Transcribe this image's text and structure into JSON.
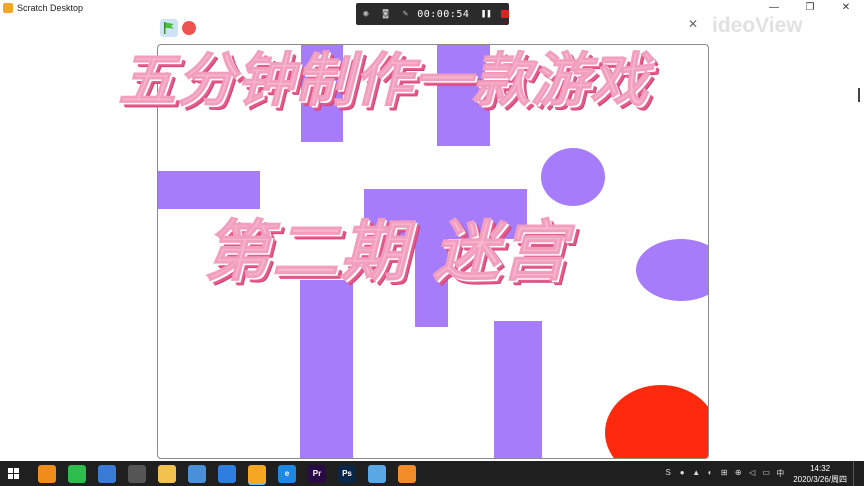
{
  "window": {
    "title": "Scratch Desktop",
    "controls": [
      "—",
      "❐",
      "✕"
    ]
  },
  "recorder": {
    "time": "00:00:54"
  },
  "watermark": {
    "text": "ideoView"
  },
  "overlay": {
    "title_line1": "五分钟制作一款游戏",
    "title_line2": "第二期 迷宫"
  },
  "colors": {
    "wall": "#a67cfa",
    "ball": "#ff2a0e",
    "title_fill": "#f7b7cf",
    "title_shadow": "#d24377"
  },
  "taskbar": {
    "apps": [
      {
        "name": "browser-icon",
        "label": "",
        "color": "#f08c1a"
      },
      {
        "name": "wechat-icon",
        "label": "",
        "color": "#2dbd4e"
      },
      {
        "name": "computer-icon",
        "label": "",
        "color": "#3a7bd5"
      },
      {
        "name": "app-icon",
        "label": "",
        "color": "#555555"
      },
      {
        "name": "folder-icon",
        "label": "",
        "color": "#f2c14e"
      },
      {
        "name": "network-icon",
        "label": "",
        "color": "#4a90d9"
      },
      {
        "name": "tiles-icon",
        "label": "",
        "color": "#2f7de1"
      },
      {
        "name": "scratch-icon",
        "label": "",
        "color": "#f5a623"
      },
      {
        "name": "ie-icon",
        "label": "e",
        "color": "#1e88e5"
      },
      {
        "name": "premiere-icon",
        "label": "Pr",
        "color": "#2a0a44"
      },
      {
        "name": "photoshop-icon",
        "label": "Ps",
        "color": "#0b2547"
      },
      {
        "name": "paint-icon",
        "label": "",
        "color": "#5aa9e6"
      },
      {
        "name": "recorder-icon",
        "label": "",
        "color": "#f28c28"
      }
    ],
    "tray_icons": [
      "S",
      "●",
      "▲",
      "◐",
      "⊞",
      "⊕",
      "◁",
      "▭",
      "中"
    ],
    "time": "14:32",
    "date": "2020/3/26/周四"
  }
}
